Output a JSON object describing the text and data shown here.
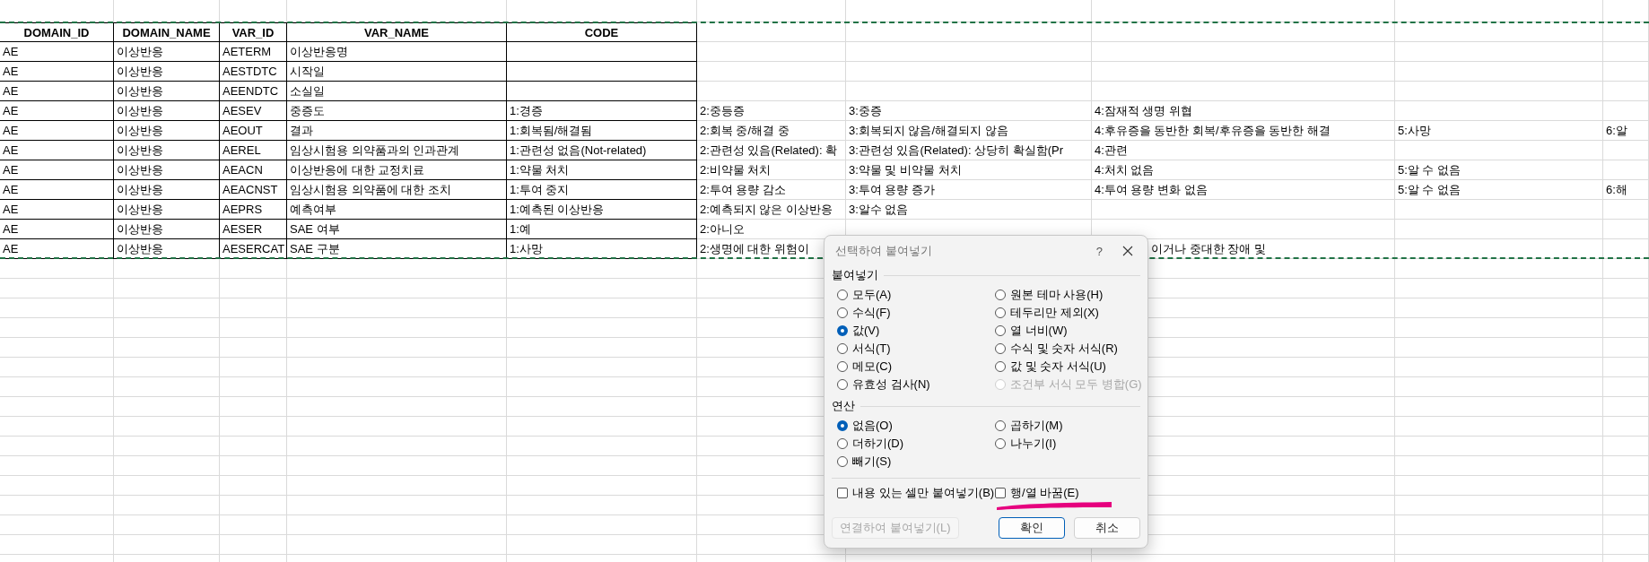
{
  "sheet": {
    "header": [
      "DOMAIN_ID",
      "DOMAIN_NAME",
      "VAR_ID",
      "VAR_NAME",
      "CODE"
    ],
    "rows": [
      {
        "domain_id": "AE",
        "domain_name": "이상반응",
        "var_id": "AETERM",
        "var_name": "이상반응명"
      },
      {
        "domain_id": "AE",
        "domain_name": "이상반응",
        "var_id": "AESTDTC",
        "var_name": "시작일"
      },
      {
        "domain_id": "AE",
        "domain_name": "이상반응",
        "var_id": "AEENDTC",
        "var_name": "소실일"
      },
      {
        "domain_id": "AE",
        "domain_name": "이상반응",
        "var_id": "AESEV",
        "var_name": "중증도",
        "codes": [
          "1:경증",
          "2:중등증",
          "3:중증",
          "4:잠재적 생명 위협"
        ]
      },
      {
        "domain_id": "AE",
        "domain_name": "이상반응",
        "var_id": "AEOUT",
        "var_name": "결과",
        "codes": [
          "1:회복됨/해결됨",
          "2:회복 중/해결 중",
          "3:회복되지 않음/해결되지 않음",
          "4:후유증을 동반한 회복/후유증을 동반한 해결",
          "5:사망",
          "6:알"
        ]
      },
      {
        "domain_id": "AE",
        "domain_name": "이상반응",
        "var_id": "AEREL",
        "var_name": "임상시험용 의약품과의 인과관계",
        "codes": [
          "1:관련성 없음(Not-related)",
          "2:관련성 있음(Related): 확",
          "3:관련성 있음(Related): 상당히 확실함(Pr",
          "4:관련"
        ]
      },
      {
        "domain_id": "AE",
        "domain_name": "이상반응",
        "var_id": "AEACN",
        "var_name": "이상반응에 대한 교정치료",
        "codes": [
          "1:약물 처치",
          "2:비약물 처치",
          "3:약물 및 비약물 처치",
          "4:처치 없음",
          "5:알 수 없음"
        ]
      },
      {
        "domain_id": "AE",
        "domain_name": "이상반응",
        "var_id": "AEACNST",
        "var_name": "임상시험용 의약품에 대한 조치",
        "codes": [
          "1:투여 중지",
          "2:투여 용량 감소",
          "3:투여 용량 증가",
          "4:투여 용량 변화 없음",
          "5:알 수 없음",
          "6:해"
        ]
      },
      {
        "domain_id": "AE",
        "domain_name": "이상반응",
        "var_id": "AEPRS",
        "var_name": "예측여부",
        "codes": [
          "1:예측된 이상반응",
          "2:예측되지 않은 이상반응",
          "3:알수 없음"
        ]
      },
      {
        "domain_id": "AE",
        "domain_name": "이상반응",
        "var_id": "AESER",
        "var_name": "SAE 여부",
        "codes": [
          "1:예",
          "2:아니오"
        ]
      },
      {
        "domain_id": "AE",
        "domain_name": "이상반응",
        "var_id": "AESERCAT",
        "var_name": "SAE 구분",
        "codes": [
          "1:사망",
          "2:생명에 대한 위험이"
        ],
        "continued_text": "이거나 중대한 장애 및"
      }
    ]
  },
  "dialog": {
    "title": "선택하여 붙여넣기",
    "help": "?",
    "sections": [
      {
        "label": "붙여넣기",
        "options": [
          {
            "label": "모두(A)",
            "selected": false,
            "disabled": false
          },
          {
            "label": "원본 테마 사용(H)",
            "selected": false,
            "disabled": false
          },
          {
            "label": "수식(F)",
            "selected": false,
            "disabled": false
          },
          {
            "label": "테두리만 제외(X)",
            "selected": false,
            "disabled": false
          },
          {
            "label": "값(V)",
            "selected": true,
            "disabled": false
          },
          {
            "label": "열 너비(W)",
            "selected": false,
            "disabled": false
          },
          {
            "label": "서식(T)",
            "selected": false,
            "disabled": false
          },
          {
            "label": "수식 및 숫자 서식(R)",
            "selected": false,
            "disabled": false
          },
          {
            "label": "메모(C)",
            "selected": false,
            "disabled": false
          },
          {
            "label": "값 및 숫자 서식(U)",
            "selected": false,
            "disabled": false
          },
          {
            "label": "유효성 검사(N)",
            "selected": false,
            "disabled": false
          },
          {
            "label": "조건부 서식 모두 병합(G)",
            "selected": false,
            "disabled": true
          }
        ]
      },
      {
        "label": "연산",
        "options": [
          {
            "label": "없음(O)",
            "selected": true,
            "disabled": false
          },
          {
            "label": "곱하기(M)",
            "selected": false,
            "disabled": false
          },
          {
            "label": "더하기(D)",
            "selected": false,
            "disabled": false
          },
          {
            "label": "나누기(I)",
            "selected": false,
            "disabled": false
          },
          {
            "label": "빼기(S)",
            "selected": false,
            "disabled": false
          }
        ]
      }
    ],
    "checkboxes": [
      {
        "label": "내용 있는 셀만 붙여넣기(B)",
        "checked": false
      },
      {
        "label": "행/열 바꿈(E)",
        "checked": false
      }
    ],
    "buttons": [
      {
        "label": "연결하여 붙여넣기(L)",
        "kind": "link",
        "disabled": true
      },
      {
        "label": "확인",
        "kind": "primary",
        "disabled": false
      },
      {
        "label": "취소",
        "kind": "secondary",
        "disabled": false
      }
    ]
  }
}
